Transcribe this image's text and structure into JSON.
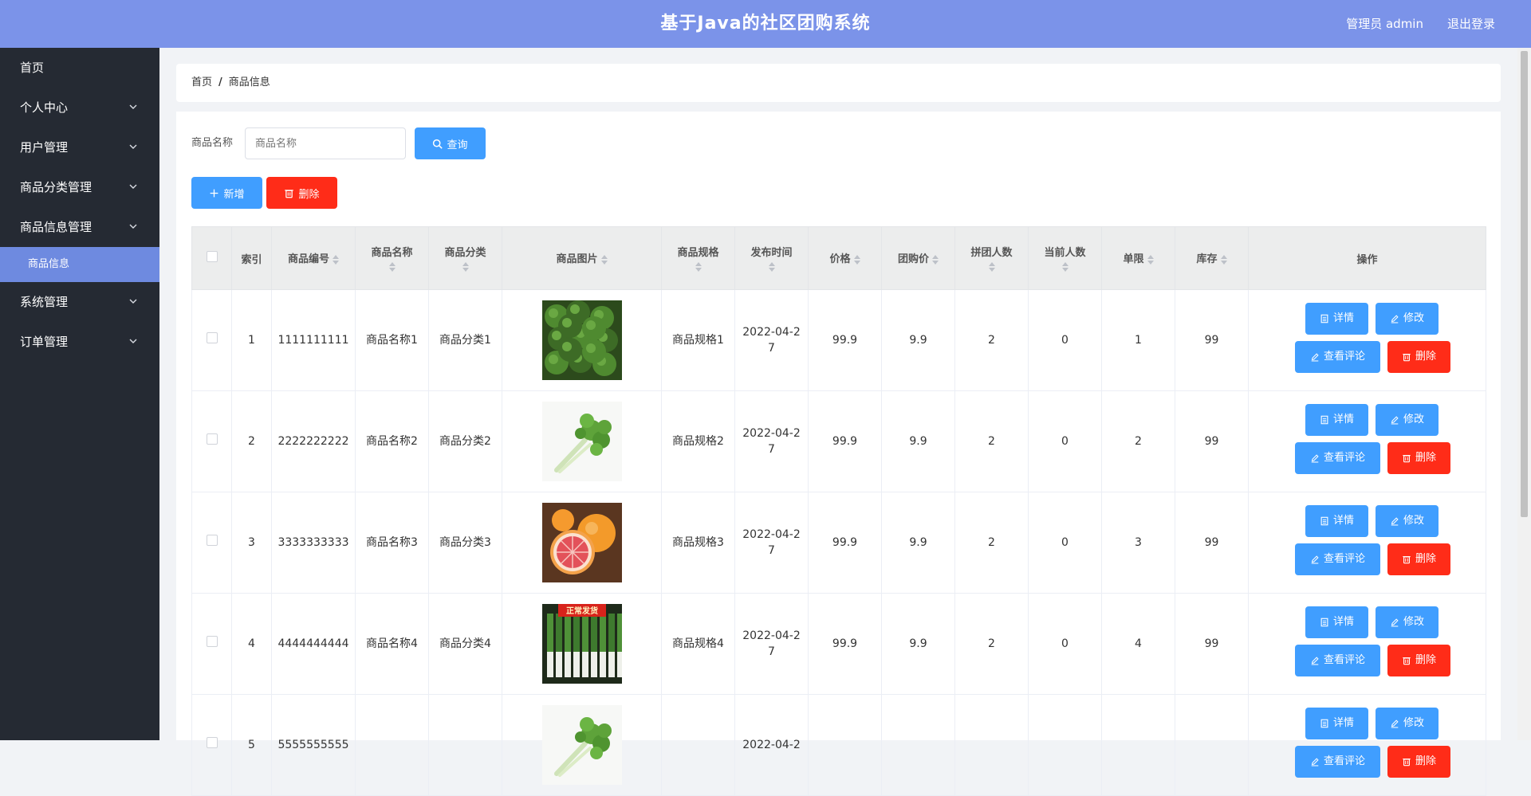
{
  "header": {
    "title": "基于Java的社区团购系统",
    "user": "管理员 admin",
    "logout": "退出登录"
  },
  "sidebar": {
    "items": [
      {
        "label": "首页",
        "has_arrow": false
      },
      {
        "label": "个人中心",
        "has_arrow": true
      },
      {
        "label": "用户管理",
        "has_arrow": true
      },
      {
        "label": "商品分类管理",
        "has_arrow": true
      },
      {
        "label": "商品信息管理",
        "has_arrow": true
      },
      {
        "label": "商品信息",
        "sub": true,
        "active": true
      },
      {
        "label": "系统管理",
        "has_arrow": true
      },
      {
        "label": "订单管理",
        "has_arrow": true
      }
    ]
  },
  "breadcrumb": {
    "home": "首页",
    "current": "商品信息"
  },
  "search": {
    "label": "商品名称",
    "placeholder": "商品名称",
    "button": "查询"
  },
  "actions": {
    "add": "新增",
    "delete": "删除"
  },
  "table": {
    "headers": {
      "index": "索引",
      "code": "商品编号",
      "name": "商品名称",
      "category": "商品分类",
      "image": "商品图片",
      "spec": "商品规格",
      "publish_time": "发布时间",
      "price": "价格",
      "group_price": "团购价",
      "group_size": "拼团人数",
      "current_count": "当前人数",
      "limit": "单限",
      "stock": "库存",
      "ops": "操作"
    },
    "op_labels": {
      "detail": "详情",
      "edit": "修改",
      "review": "查看评论",
      "delete": "删除"
    },
    "image_overlay_text": "正常发货",
    "rows": [
      {
        "index": "1",
        "code": "1111111111",
        "name": "商品名称1",
        "category": "商品分类1",
        "image": "broccoli",
        "spec": "商品规格1",
        "publish_time": "2022-04-27",
        "price": "99.9",
        "group_price": "9.9",
        "group_size": "2",
        "current_count": "0",
        "limit": "1",
        "stock": "99"
      },
      {
        "index": "2",
        "code": "2222222222",
        "name": "商品名称2",
        "category": "商品分类2",
        "image": "celery",
        "spec": "商品规格2",
        "publish_time": "2022-04-27",
        "price": "99.9",
        "group_price": "9.9",
        "group_size": "2",
        "current_count": "0",
        "limit": "2",
        "stock": "99"
      },
      {
        "index": "3",
        "code": "3333333333",
        "name": "商品名称3",
        "category": "商品分类3",
        "image": "grapefruit",
        "spec": "商品规格3",
        "publish_time": "2022-04-27",
        "price": "99.9",
        "group_price": "9.9",
        "group_size": "2",
        "current_count": "0",
        "limit": "3",
        "stock": "99"
      },
      {
        "index": "4",
        "code": "4444444444",
        "name": "商品名称4",
        "category": "商品分类4",
        "image": "leek",
        "spec": "商品规格4",
        "publish_time": "2022-04-27",
        "price": "99.9",
        "group_price": "9.9",
        "group_size": "2",
        "current_count": "0",
        "limit": "4",
        "stock": "99"
      },
      {
        "index": "5",
        "code": "5555555555",
        "name": "",
        "category": "",
        "image": "celery",
        "spec": "",
        "publish_time": "2022-04-2",
        "price": "",
        "group_price": "",
        "group_size": "",
        "current_count": "",
        "limit": "",
        "stock": ""
      }
    ]
  },
  "colors": {
    "header_bg": "#7b93e9",
    "sidebar_bg": "#252a33",
    "active_menu": "#6e8ae0",
    "primary": "#409eff",
    "danger": "#ff2c18"
  }
}
